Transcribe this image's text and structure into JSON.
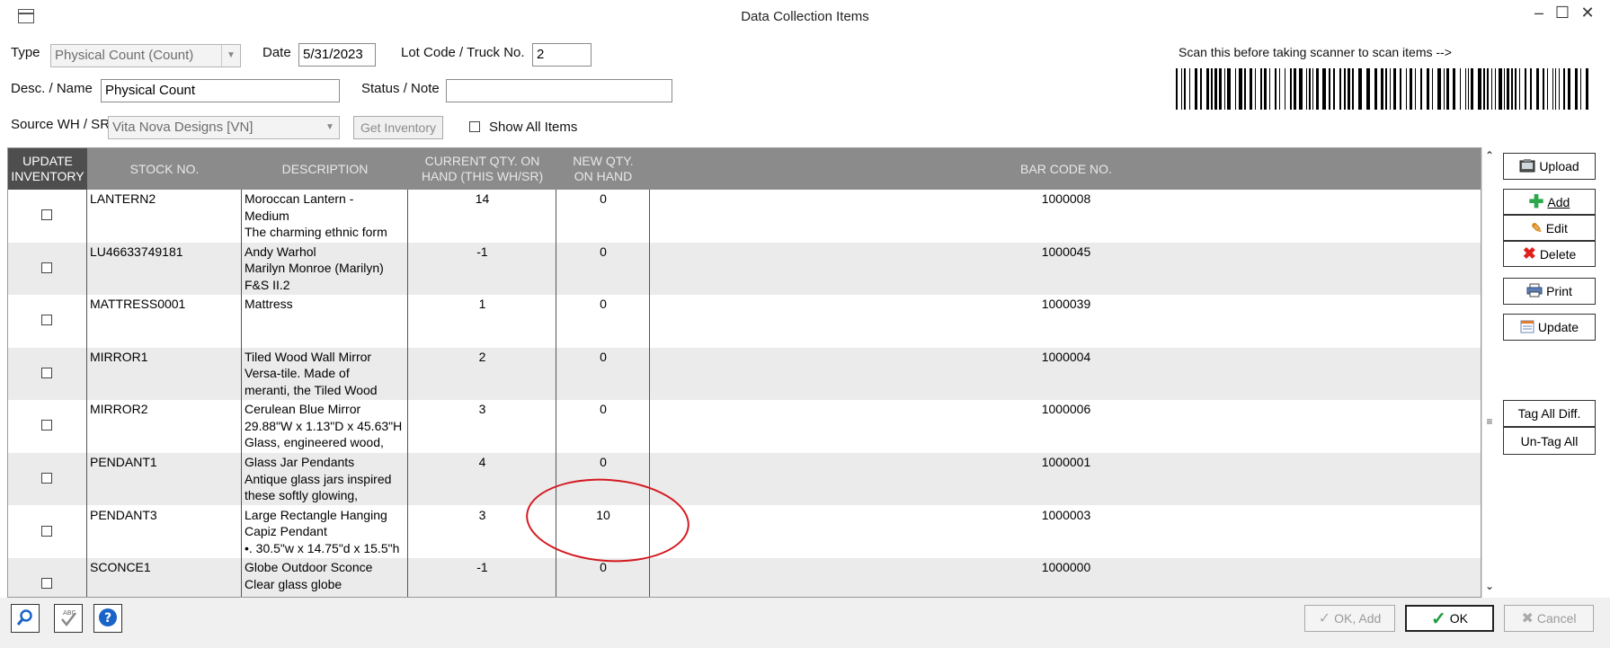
{
  "window": {
    "title": "Data Collection Items",
    "minimize": "–",
    "maximize": "☐",
    "close": "✕"
  },
  "form": {
    "type_label": "Type",
    "type_value": "Physical Count (Count)",
    "date_label": "Date",
    "date_value": "5/31/2023",
    "lot_label": "Lot Code / Truck No.",
    "lot_value": "2",
    "desc_label": "Desc. / Name",
    "desc_value": "Physical Count",
    "status_label": "Status / Note",
    "status_value": "",
    "source_label": "Source WH / SR",
    "source_value": "Vita Nova Designs [VN]",
    "get_inventory": "Get Inventory",
    "show_all_items": "Show All Items",
    "scan_note": "Scan this before taking scanner to scan items -->"
  },
  "table": {
    "columns": [
      "UPDATE INVENTORY",
      "STOCK NO.",
      "DESCRIPTION",
      "CURRENT QTY. ON HAND (THIS WH/SR)",
      "NEW QTY. ON HAND",
      "BAR CODE NO."
    ],
    "rows": [
      {
        "stock": "LANTERN2",
        "desc": [
          "Moroccan Lantern -",
          "Medium",
          "The charming ethnic form"
        ],
        "current": "14",
        "new": "0",
        "barcode": "1000008"
      },
      {
        "stock": "LU46633749181",
        "desc": [
          "Andy Warhol",
          "Marilyn Monroe (Marilyn)",
          "F&S II.2"
        ],
        "current": "-1",
        "new": "0",
        "barcode": "1000045"
      },
      {
        "stock": "MATTRESS0001",
        "desc": [
          "Mattress"
        ],
        "current": "1",
        "new": "0",
        "barcode": "1000039"
      },
      {
        "stock": "MIRROR1",
        "desc": [
          "Tiled Wood Wall Mirror",
          "Versa-tile. Made of",
          "meranti, the Tiled Wood"
        ],
        "current": "2",
        "new": "0",
        "barcode": "1000004"
      },
      {
        "stock": "MIRROR2",
        "desc": [
          "Cerulean Blue Mirror",
          "29.88\"W x 1.13\"D x 45.63\"H",
          "Glass, engineered wood,"
        ],
        "current": "3",
        "new": "0",
        "barcode": "1000006"
      },
      {
        "stock": "PENDANT1",
        "desc": [
          "Glass Jar Pendants",
          "Antique glass jars inspired",
          "these softly glowing,"
        ],
        "current": "4",
        "new": "0",
        "barcode": "1000001"
      },
      {
        "stock": "PENDANT3",
        "desc": [
          "Large Rectangle Hanging",
          "Capiz Pendant",
          "•. 30.5\"w x 14.75\"d x 15.5\"h"
        ],
        "current": "3",
        "new": "10",
        "barcode": "1000003"
      },
      {
        "stock": "SCONCE1",
        "desc": [
          "Globe Outdoor Sconce",
          "Clear glass globe"
        ],
        "current": "-1",
        "new": "0",
        "barcode": "1000000"
      }
    ]
  },
  "side_buttons": {
    "upload": "Upload",
    "add": "Add",
    "edit": "Edit",
    "delete": "Delete",
    "print": "Print",
    "update": "Update",
    "tag_all_diff": "Tag All Diff.",
    "untag_all": "Un-Tag All"
  },
  "bottom": {
    "ok_add": "OK, Add",
    "ok": "OK",
    "cancel": "Cancel"
  },
  "icons": [
    "app-window-icon",
    "upload-icon",
    "add-icon",
    "edit-icon",
    "delete-icon",
    "print-icon",
    "update-icon",
    "search-icon",
    "spellcheck-icon",
    "help-icon",
    "checkmark-icon",
    "cancel-icon"
  ],
  "colors": {
    "header_bg": "#8b8b8b",
    "header_first_bg": "#4e4e4e",
    "alt_row": "#ebebeb",
    "annotation": "#d4191f",
    "add_green": "#2aa84a",
    "delete_red": "#e0201a",
    "help_blue": "#1a64c8"
  }
}
